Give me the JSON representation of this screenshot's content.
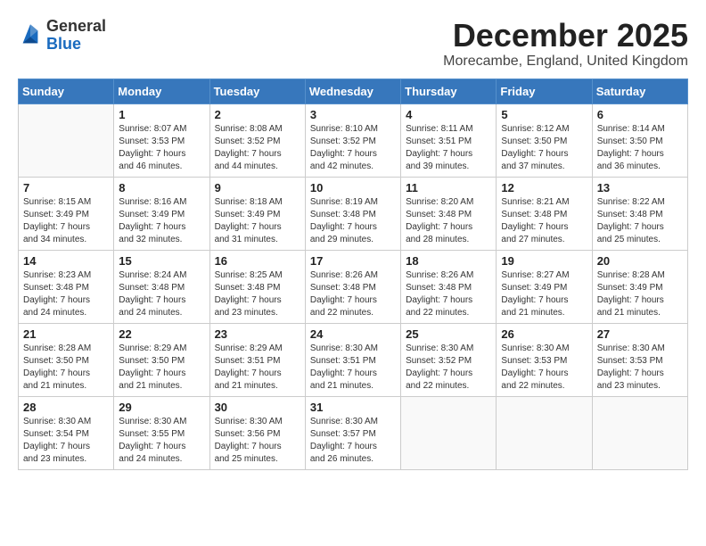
{
  "header": {
    "logo": {
      "general": "General",
      "blue": "Blue"
    },
    "title": "December 2025",
    "location": "Morecambe, England, United Kingdom"
  },
  "calendar": {
    "days_of_week": [
      "Sunday",
      "Monday",
      "Tuesday",
      "Wednesday",
      "Thursday",
      "Friday",
      "Saturday"
    ],
    "weeks": [
      [
        {
          "day": "",
          "info": ""
        },
        {
          "day": "1",
          "info": "Sunrise: 8:07 AM\nSunset: 3:53 PM\nDaylight: 7 hours\nand 46 minutes."
        },
        {
          "day": "2",
          "info": "Sunrise: 8:08 AM\nSunset: 3:52 PM\nDaylight: 7 hours\nand 44 minutes."
        },
        {
          "day": "3",
          "info": "Sunrise: 8:10 AM\nSunset: 3:52 PM\nDaylight: 7 hours\nand 42 minutes."
        },
        {
          "day": "4",
          "info": "Sunrise: 8:11 AM\nSunset: 3:51 PM\nDaylight: 7 hours\nand 39 minutes."
        },
        {
          "day": "5",
          "info": "Sunrise: 8:12 AM\nSunset: 3:50 PM\nDaylight: 7 hours\nand 37 minutes."
        },
        {
          "day": "6",
          "info": "Sunrise: 8:14 AM\nSunset: 3:50 PM\nDaylight: 7 hours\nand 36 minutes."
        }
      ],
      [
        {
          "day": "7",
          "info": "Sunrise: 8:15 AM\nSunset: 3:49 PM\nDaylight: 7 hours\nand 34 minutes."
        },
        {
          "day": "8",
          "info": "Sunrise: 8:16 AM\nSunset: 3:49 PM\nDaylight: 7 hours\nand 32 minutes."
        },
        {
          "day": "9",
          "info": "Sunrise: 8:18 AM\nSunset: 3:49 PM\nDaylight: 7 hours\nand 31 minutes."
        },
        {
          "day": "10",
          "info": "Sunrise: 8:19 AM\nSunset: 3:48 PM\nDaylight: 7 hours\nand 29 minutes."
        },
        {
          "day": "11",
          "info": "Sunrise: 8:20 AM\nSunset: 3:48 PM\nDaylight: 7 hours\nand 28 minutes."
        },
        {
          "day": "12",
          "info": "Sunrise: 8:21 AM\nSunset: 3:48 PM\nDaylight: 7 hours\nand 27 minutes."
        },
        {
          "day": "13",
          "info": "Sunrise: 8:22 AM\nSunset: 3:48 PM\nDaylight: 7 hours\nand 25 minutes."
        }
      ],
      [
        {
          "day": "14",
          "info": "Sunrise: 8:23 AM\nSunset: 3:48 PM\nDaylight: 7 hours\nand 24 minutes."
        },
        {
          "day": "15",
          "info": "Sunrise: 8:24 AM\nSunset: 3:48 PM\nDaylight: 7 hours\nand 24 minutes."
        },
        {
          "day": "16",
          "info": "Sunrise: 8:25 AM\nSunset: 3:48 PM\nDaylight: 7 hours\nand 23 minutes."
        },
        {
          "day": "17",
          "info": "Sunrise: 8:26 AM\nSunset: 3:48 PM\nDaylight: 7 hours\nand 22 minutes."
        },
        {
          "day": "18",
          "info": "Sunrise: 8:26 AM\nSunset: 3:48 PM\nDaylight: 7 hours\nand 22 minutes."
        },
        {
          "day": "19",
          "info": "Sunrise: 8:27 AM\nSunset: 3:49 PM\nDaylight: 7 hours\nand 21 minutes."
        },
        {
          "day": "20",
          "info": "Sunrise: 8:28 AM\nSunset: 3:49 PM\nDaylight: 7 hours\nand 21 minutes."
        }
      ],
      [
        {
          "day": "21",
          "info": "Sunrise: 8:28 AM\nSunset: 3:50 PM\nDaylight: 7 hours\nand 21 minutes."
        },
        {
          "day": "22",
          "info": "Sunrise: 8:29 AM\nSunset: 3:50 PM\nDaylight: 7 hours\nand 21 minutes."
        },
        {
          "day": "23",
          "info": "Sunrise: 8:29 AM\nSunset: 3:51 PM\nDaylight: 7 hours\nand 21 minutes."
        },
        {
          "day": "24",
          "info": "Sunrise: 8:30 AM\nSunset: 3:51 PM\nDaylight: 7 hours\nand 21 minutes."
        },
        {
          "day": "25",
          "info": "Sunrise: 8:30 AM\nSunset: 3:52 PM\nDaylight: 7 hours\nand 22 minutes."
        },
        {
          "day": "26",
          "info": "Sunrise: 8:30 AM\nSunset: 3:53 PM\nDaylight: 7 hours\nand 22 minutes."
        },
        {
          "day": "27",
          "info": "Sunrise: 8:30 AM\nSunset: 3:53 PM\nDaylight: 7 hours\nand 23 minutes."
        }
      ],
      [
        {
          "day": "28",
          "info": "Sunrise: 8:30 AM\nSunset: 3:54 PM\nDaylight: 7 hours\nand 23 minutes."
        },
        {
          "day": "29",
          "info": "Sunrise: 8:30 AM\nSunset: 3:55 PM\nDaylight: 7 hours\nand 24 minutes."
        },
        {
          "day": "30",
          "info": "Sunrise: 8:30 AM\nSunset: 3:56 PM\nDaylight: 7 hours\nand 25 minutes."
        },
        {
          "day": "31",
          "info": "Sunrise: 8:30 AM\nSunset: 3:57 PM\nDaylight: 7 hours\nand 26 minutes."
        },
        {
          "day": "",
          "info": ""
        },
        {
          "day": "",
          "info": ""
        },
        {
          "day": "",
          "info": ""
        }
      ]
    ]
  }
}
